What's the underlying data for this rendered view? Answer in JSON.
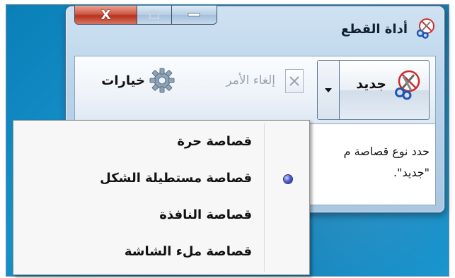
{
  "window": {
    "title": "أداة القطع",
    "caption_buttons": {
      "close_glyph": "X",
      "maximize_glyph": "□",
      "minimize_glyph": "—"
    }
  },
  "toolbar": {
    "new_label": "جديد",
    "cancel_label": "إلغاء الأمر",
    "options_label": "خيارات"
  },
  "content": {
    "description": "حدد نوع قصاصة م\n\"جديد\"."
  },
  "menu": {
    "items": [
      {
        "label": "قصاصة حرة",
        "selected": false
      },
      {
        "label": "قصاصة مستطيلة الشكل",
        "selected": true
      },
      {
        "label": "قصاصة النافذة",
        "selected": false
      },
      {
        "label": "قصاصة ملء الشاشة",
        "selected": false
      }
    ]
  },
  "colors": {
    "desktop": "#1790c9",
    "close_button": "#cf5a45",
    "radio_dot": "#4d5fd0"
  }
}
